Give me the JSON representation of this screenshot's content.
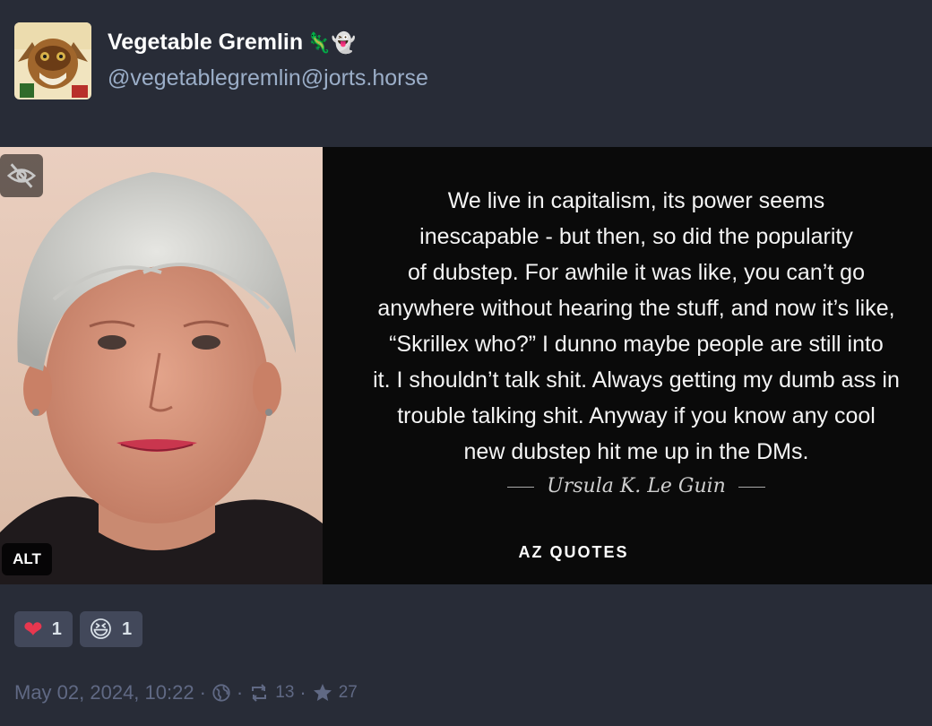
{
  "account": {
    "display_name": "Vegetable Gremlin",
    "name_emoji": "🦎👻",
    "handle": "@vegetablegremlin@jorts.horse",
    "avatar_icon": "gremlin-avatar"
  },
  "media": {
    "alt_label": "ALT",
    "hide_icon": "eye-slash-icon",
    "quote_text": "We live in capitalism, its power seems\ninescapable - but then, so did the popularity\nof dubstep. For awhile it was like, you can’t go\nanywhere without hearing the stuff, and now it’s like,\n“Skrillex who?” I dunno maybe people are still into\nit. I shouldn’t talk shit. Always getting my dumb ass in\ntrouble talking shit. Anyway if you know any cool\nnew dubstep hit me up in the DMs.",
    "attribution": "Ursula K. Le Guin",
    "brand": "AZ QUOTES"
  },
  "reactions": [
    {
      "emoji": "❤",
      "count": "1",
      "icon": "heart-icon"
    },
    {
      "emoji": "😆",
      "count": "1",
      "icon": "laughing-icon"
    }
  ],
  "meta": {
    "timestamp": "May 02, 2024, 10:22",
    "separator": "·",
    "visibility_icon": "globe-icon",
    "boost_icon": "retweet-icon",
    "boosts": "13",
    "favourite_icon": "star-icon",
    "favourites": "27"
  },
  "colors": {
    "background": "#282c37",
    "display_name": "#ffffff",
    "handle": "#9baec8",
    "meta": "#606984",
    "reaction_bg": "#42485a"
  }
}
